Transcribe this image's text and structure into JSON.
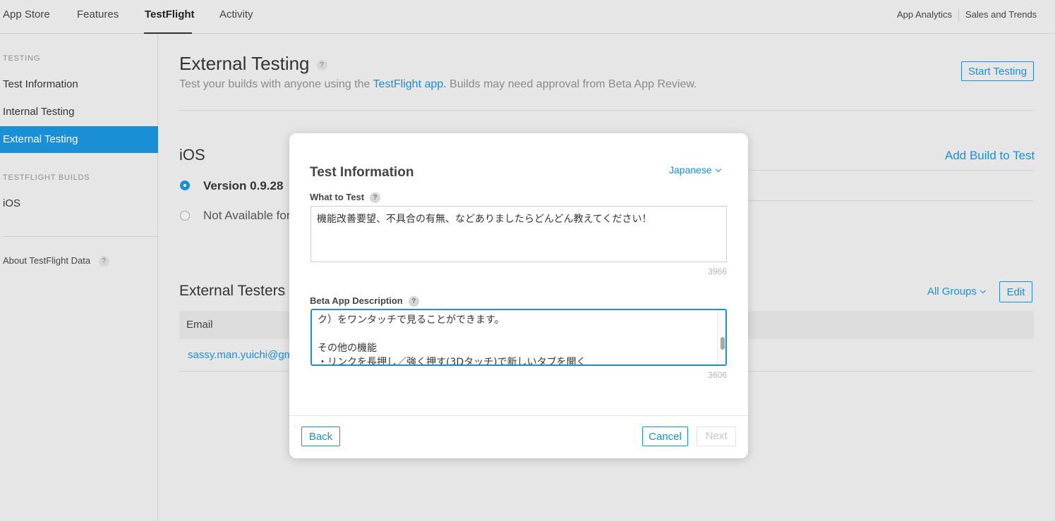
{
  "topnav": {
    "tabs": [
      "App Store",
      "Features",
      "TestFlight",
      "Activity"
    ],
    "active_tab": "TestFlight",
    "right_links": [
      "App Analytics",
      "Sales and Trends"
    ]
  },
  "sidebar": {
    "testing_header": "TESTING",
    "items": [
      "Test Information",
      "Internal Testing",
      "External Testing"
    ],
    "active_item": "External Testing",
    "builds_header": "TESTFLIGHT BUILDS",
    "builds_items": [
      "iOS"
    ],
    "about": "About TestFlight Data",
    "help_glyph": "?"
  },
  "main": {
    "title": "External Testing",
    "subtitle_pre": "Test your builds with anyone using the ",
    "subtitle_link": "TestFlight app.",
    "subtitle_post": " Builds may need approval from Beta App Review.",
    "start_testing": "Start Testing",
    "platform": "iOS",
    "add_build": "Add Build to Test",
    "version_label": "Version 0.9.28",
    "not_available": "Not Available for",
    "external_testers": "External Testers (",
    "all_groups": "All Groups",
    "edit": "Edit",
    "email_header": "Email",
    "email_value": "sassy.man.yuichi@gma"
  },
  "modal": {
    "title": "Test Information",
    "language": "Japanese",
    "what_to_test_label": "What to Test",
    "what_to_test_value": "機能改善要望、不具合の有無、などありましたらどんどん教えてください！",
    "what_to_test_counter": "3966",
    "beta_desc_label": "Beta App Description",
    "beta_desc_line1": "ク）をワンタッチで見ることができます。",
    "beta_desc_line2": "その他の機能",
    "beta_desc_line3": "・リンクを長押し／強く押す(3Dタッチ)で新しいタブを開く",
    "beta_desc_counter": "3606",
    "back": "Back",
    "cancel": "Cancel",
    "next": "Next"
  },
  "colors": {
    "accent": "#1a8fd6",
    "background": "#e6e6e6",
    "modal_bg": "#ffffff"
  }
}
